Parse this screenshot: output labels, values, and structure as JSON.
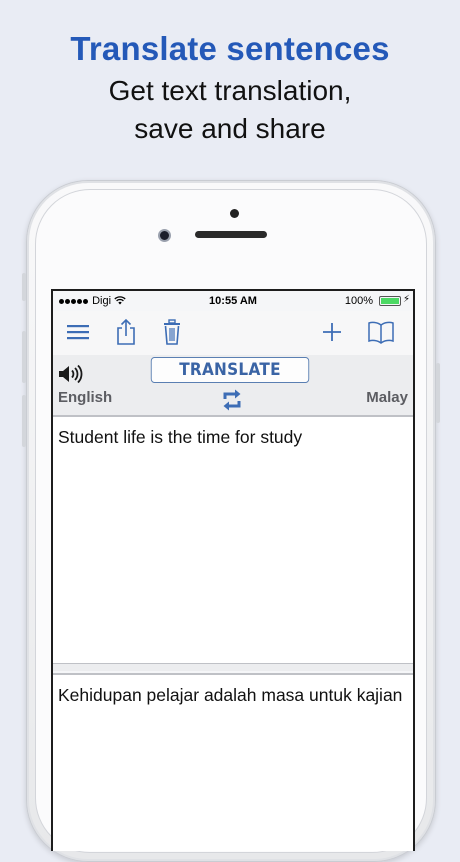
{
  "promo": {
    "headline": "Translate sentences",
    "sub_line1": "Get text translation,",
    "sub_line2": "save and share"
  },
  "status_bar": {
    "carrier": "Digi",
    "time": "10:55 AM",
    "battery": "100%",
    "battery_level": 1.0
  },
  "toolbar": {
    "icons": [
      "menu-icon",
      "share-icon",
      "trash-icon",
      "plus-icon",
      "book-icon"
    ]
  },
  "translator": {
    "translate_label": "TRANSLATE",
    "source_language": "English",
    "target_language": "Malay",
    "source_text": "Student life is the time for study",
    "translated_text": "Kehidupan pelajar adalah masa untuk kajian"
  },
  "colors": {
    "accent": "#2459b8",
    "toolbar_icon": "#3d6db5",
    "battery": "#4cd964"
  }
}
